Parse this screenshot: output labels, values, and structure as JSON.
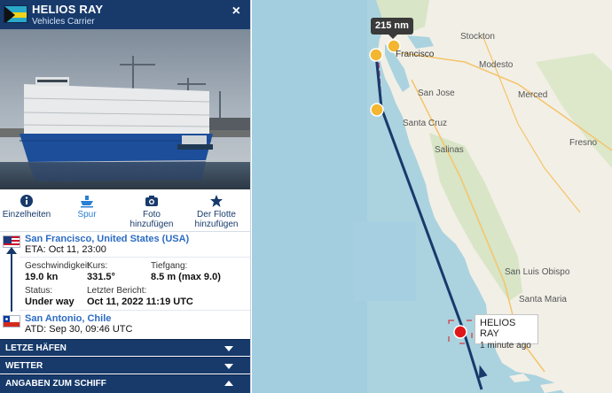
{
  "header": {
    "ship_name": "HELIOS RAY",
    "ship_type": "Vehicles Carrier",
    "close_label": "×",
    "flag_icon": "bahamas-flag-icon"
  },
  "tabs": [
    {
      "label": "Einzelheiten",
      "icon": "info-icon"
    },
    {
      "label": "Spur",
      "icon": "ship-icon"
    },
    {
      "label": "Foto hinzufügen",
      "icon": "camera-icon"
    },
    {
      "label": "Der Flotte hinzufügen",
      "icon": "star-icon"
    }
  ],
  "voyage": {
    "destination": "San Francisco, United States (USA)",
    "eta": "ETA: Oct 11, 23:00",
    "origin": "San Antonio, Chile",
    "atd": "ATD: Sep 30, 09:46 UTC"
  },
  "details": {
    "speed_label": "Geschwindigkeit",
    "course_label": "Kurs:",
    "draught_label": "Tiefgang:",
    "speed_value": "19.0 kn",
    "course_value": "331.5°",
    "draught_value": "8.5 m (max 9.0)",
    "status_label": "Status:",
    "report_label": "Letzter Bericht:",
    "status_value": "Under way",
    "report_value": "Oct 11, 2022 11:19 UTC"
  },
  "sections": [
    {
      "label": "LETZE HÄFEN",
      "expanded": false
    },
    {
      "label": "WETTER",
      "expanded": false
    },
    {
      "label": "ANGABEN ZUM SCHIFF",
      "expanded": true
    }
  ],
  "map": {
    "distance": "215 nm",
    "ship_label": "HELIOS RAY",
    "ship_time": "1 minute ago",
    "cities": {
      "stockton": "Stockton",
      "san_francisco": "Francisco",
      "modesto": "Modesto",
      "san_jose": "San Jose",
      "merced": "Merced",
      "santa_cruz": "Santa Cruz",
      "salinas": "Salinas",
      "fresno": "Fresno",
      "san_luis_obispo": "San Luis Obispo",
      "santa_maria": "Santa Maria"
    },
    "colors": {
      "track": "#173a6b",
      "route": "#c0326e",
      "ship": "#e0161b",
      "waypoint": "#f2b630"
    }
  }
}
